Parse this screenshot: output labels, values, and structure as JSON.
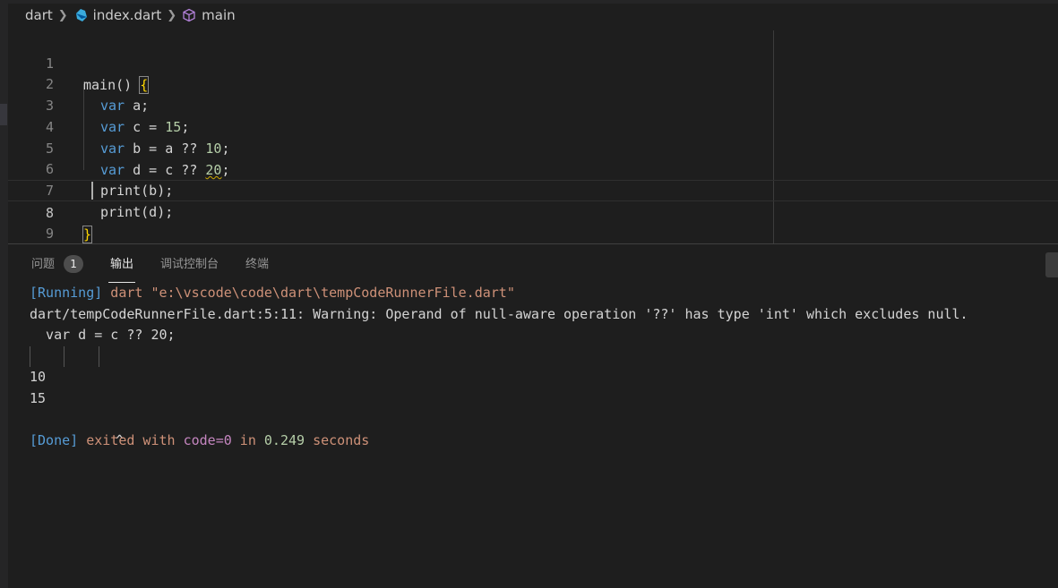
{
  "breadcrumb": {
    "folder": "dart",
    "file": "index.dart",
    "symbol": "main"
  },
  "editor": {
    "lines": [
      {
        "num": "1"
      },
      {
        "num": "2"
      },
      {
        "num": "3"
      },
      {
        "num": "4"
      },
      {
        "num": "5"
      },
      {
        "num": "6"
      },
      {
        "num": "7"
      },
      {
        "num": "8"
      },
      {
        "num": "9"
      }
    ],
    "code": {
      "l1_fn": "main",
      "l1_paren": "() ",
      "l1_brace": "{",
      "l2_kw": "var",
      "l2_rest": " a;",
      "l3_kw": "var",
      "l3_rest": " c = ",
      "l3_num": "15",
      "l3_end": ";",
      "l4_kw": "var",
      "l4_rest": " b = a ?? ",
      "l4_num": "10",
      "l4_end": ";",
      "l5_kw": "var",
      "l5_rest": " d = c ?? ",
      "l5_num": "20",
      "l5_end": ";",
      "l6": "print(b);",
      "l7": "print(d);",
      "l8_brace": "}"
    }
  },
  "panel": {
    "tabs": {
      "problems": "问题",
      "problems_count": "1",
      "output": "输出",
      "debug_console": "调试控制台",
      "terminal": "终端"
    },
    "output": {
      "running_tag": "[Running]",
      "running_cmd": " dart \"e:\\vscode\\code\\dart\\tempCodeRunnerFile.dart\"",
      "warning": "dart/tempCodeRunnerFile.dart:5:11: Warning: Operand of null-aware operation '??' has type 'int' which excludes null.",
      "snippet": "  var d = c ?? 20;",
      "caret": "^",
      "result1": "10",
      "result2": "15",
      "done_tag": "[Done]",
      "done_text1": " exited with ",
      "done_code": "code=0",
      "done_text2": " in ",
      "done_time": "0.249",
      "done_text3": " seconds"
    }
  },
  "colors": {
    "background": "#1e1e1e",
    "keyword": "#569cd6",
    "number": "#b5cea8",
    "string": "#ce9178",
    "accent": "#c586c0"
  }
}
